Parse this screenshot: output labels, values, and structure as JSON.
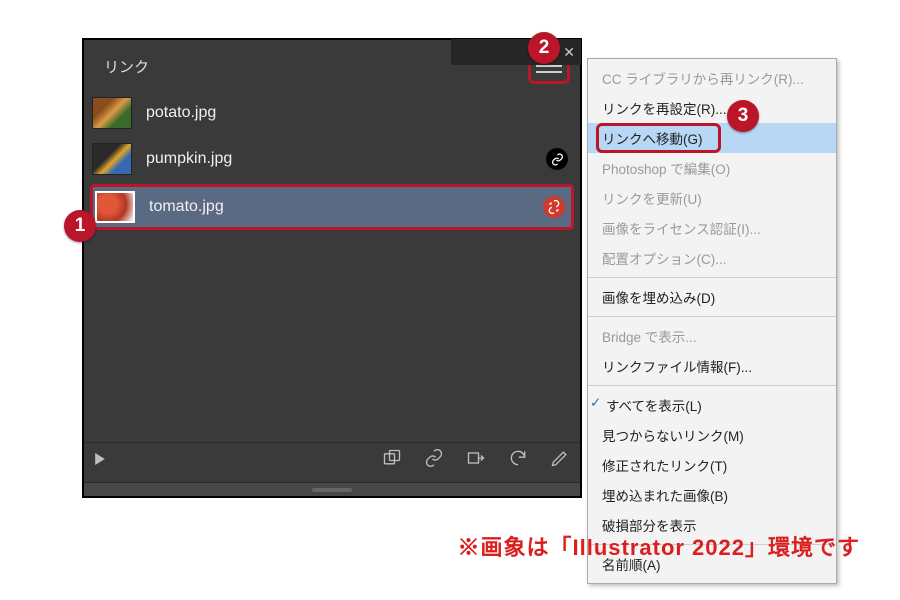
{
  "panel": {
    "tab": "リンク",
    "rows": [
      {
        "file": "potato.jpg",
        "status": ""
      },
      {
        "file": "pumpkin.jpg",
        "status": "linked"
      },
      {
        "file": "tomato.jpg",
        "status": "broken"
      }
    ]
  },
  "menu": {
    "items": [
      {
        "label": "CC ライブラリから再リンク(R)...",
        "state": "disabled"
      },
      {
        "label": "リンクを再設定(R)...",
        "state": ""
      },
      {
        "label": "リンクへ移動(G)",
        "state": "highlight"
      },
      {
        "label": "Photoshop で編集(O)",
        "state": "disabled"
      },
      {
        "label": "リンクを更新(U)",
        "state": "disabled"
      },
      {
        "label": "画像をライセンス認証(I)...",
        "state": "disabled"
      },
      {
        "label": "配置オプション(C)...",
        "state": "disabled"
      },
      {
        "sep": true
      },
      {
        "label": "画像を埋め込み(D)",
        "state": ""
      },
      {
        "sep": true
      },
      {
        "label": "Bridge で表示...",
        "state": "disabled"
      },
      {
        "label": "リンクファイル情報(F)...",
        "state": ""
      },
      {
        "sep": true
      },
      {
        "label": "すべてを表示(L)",
        "state": "check"
      },
      {
        "label": "見つからないリンク(M)",
        "state": ""
      },
      {
        "label": "修正されたリンク(T)",
        "state": ""
      },
      {
        "label": "埋め込まれた画像(B)",
        "state": ""
      },
      {
        "label": "破損部分を表示",
        "state": ""
      },
      {
        "sep": true
      },
      {
        "label": "名前順(A)",
        "state": ""
      }
    ]
  },
  "badges": {
    "b1": "1",
    "b2": "2",
    "b3": "3"
  },
  "caption": "※画象は「Illustrator 2022」環境です"
}
